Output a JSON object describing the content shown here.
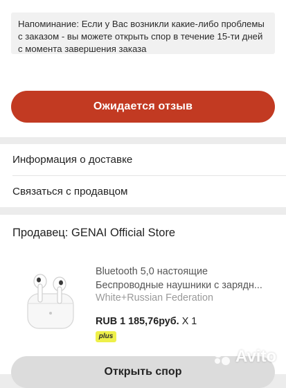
{
  "notice": {
    "text": "Напоминание: Если у Вас возникли какие-либо проблемы с заказом - вы можете открыть спор в течение 15-ти дней с момента завершения заказа"
  },
  "primary_action": {
    "label": "Ожидается отзыв",
    "color": "#c23a22"
  },
  "links": {
    "delivery_info": "Информация о доставке",
    "contact_seller": "Связаться с продавцом"
  },
  "seller": {
    "title": "Продавец: GENAI Official Store"
  },
  "product": {
    "image_icon": "earbuds-image",
    "name_line1": "Bluetooth 5,0 настоящие",
    "name_line2": "Беспроводные наушники с зарядн...",
    "variant": "White+Russian Federation",
    "price": "RUB 1 185,76руб.",
    "quantity": "X 1",
    "badge": "plus",
    "badge_color": "#eef04a"
  },
  "secondary_action": {
    "label": "Открыть спор"
  },
  "watermark": {
    "text": "Avito"
  }
}
